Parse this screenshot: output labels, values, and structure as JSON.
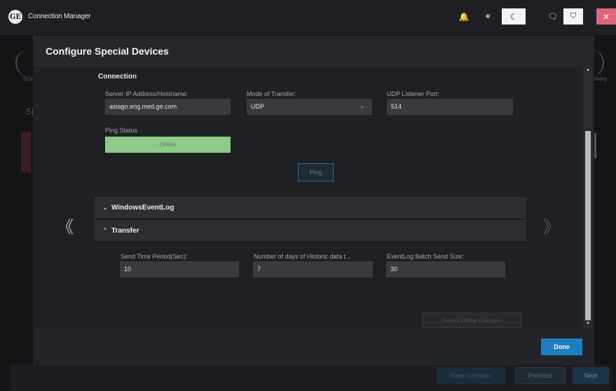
{
  "window": {
    "title": "Connection Manager",
    "logo_text": "GE"
  },
  "toolbar": {
    "bell_icon": "🔔",
    "sun_icon": "☀",
    "moon_icon": "☾",
    "chat_icon": "🗨",
    "shield_icon": "⛉",
    "close_icon": "✕"
  },
  "background": {
    "left_text": "Sca",
    "left_heading": "S|",
    "right_text": "mary",
    "save_continue_label": "Save Continue",
    "previous_label": "Previous",
    "next_label": "Next"
  },
  "modal": {
    "title": "Configure Special Devices",
    "nav_left": "《",
    "nav_right": "》",
    "connection": {
      "heading": "Connection",
      "server_label": "Server IP Address/Hostname:",
      "server_value": "asiago.eng.med.ge.com",
      "mode_label": "Mode of Transfer:",
      "mode_value": "UDP",
      "mode_chevron": "⌄",
      "port_label": "UDP Listener Port:",
      "port_value": "514",
      "ping_status_label": "Ping Status",
      "ping_status_value": "Online",
      "ping_button": "Ping"
    },
    "sections": {
      "windows_event_log": {
        "label": "WindowsEventLog",
        "chevron": "⌄"
      },
      "transfer": {
        "label": "Transfer",
        "chevron": "⌃"
      }
    },
    "transfer": {
      "send_period_label": "Send Time Period(Sec):",
      "send_period_value": "10",
      "historic_days_label": "Number of days of Historic data t...",
      "historic_days_value": "7",
      "batch_size_label": "EventLog Batch Send Size:",
      "batch_size_value": "30"
    },
    "save_changes_label": "Save Existing Changes",
    "done_label": "Done"
  }
}
